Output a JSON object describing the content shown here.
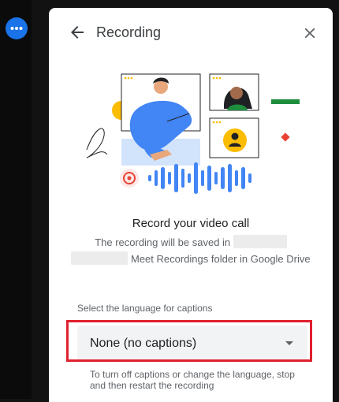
{
  "sidebar": {
    "more_icon": "more-horizontal-icon",
    "accent": "#1a73e8"
  },
  "panel": {
    "title": "Recording",
    "back_icon": "arrow-back-icon",
    "close_icon": "close-icon",
    "heading": "Record your video call",
    "description_part1": "The recording will be saved in",
    "description_part2": "Meet Recordings folder in Google Drive",
    "language_label": "Select the language for captions",
    "language_selected": "None (no captions)",
    "helper_text": "To turn off captions or change the language, stop and then restart the recording"
  },
  "colors": {
    "highlight_border": "#e0202e",
    "primary_blue": "#4285f4",
    "green": "#1e8e3e",
    "red": "#ea4335",
    "yellow": "#fbbc04"
  }
}
